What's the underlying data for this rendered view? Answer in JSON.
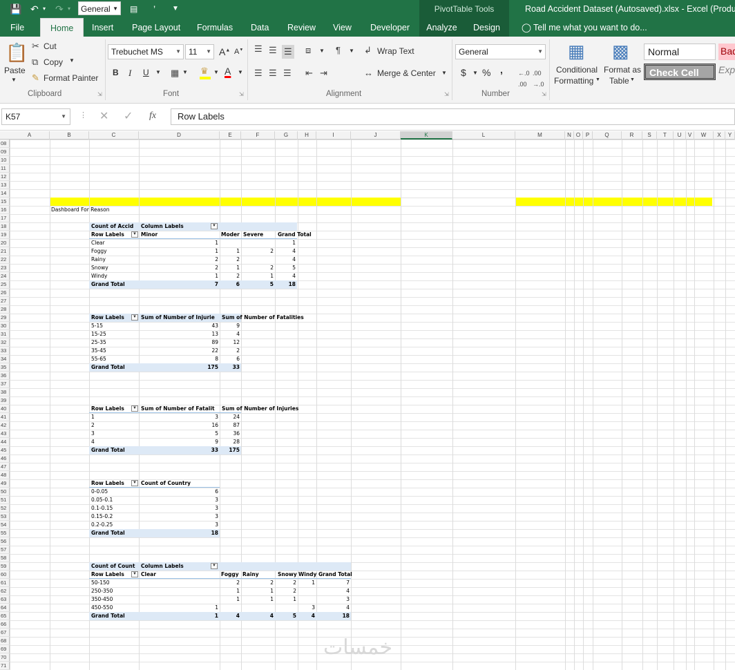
{
  "titlebar": {
    "number_format_box": "General",
    "contextual_group": "PivotTable Tools",
    "document_title": "Road Accident Dataset (Autosaved).xlsx - Excel (Product A"
  },
  "tabs": [
    "File",
    "Home",
    "Insert",
    "Page Layout",
    "Formulas",
    "Data",
    "Review",
    "View",
    "Developer",
    "Analyze",
    "Design"
  ],
  "tell_me": "Tell me what you want to do...",
  "ribbon": {
    "clipboard": {
      "paste": "Paste",
      "cut": "Cut",
      "copy": "Copy",
      "format_painter": "Format Painter",
      "label": "Clipboard"
    },
    "font": {
      "name": "Trebuchet MS",
      "size": "11",
      "bold": "B",
      "italic": "I",
      "underline": "U",
      "label": "Font"
    },
    "alignment": {
      "wrap_text": "Wrap Text",
      "merge_center": "Merge & Center",
      "label": "Alignment"
    },
    "number": {
      "format": "General",
      "currency": "$",
      "percent": "%",
      "comma": ",",
      "label": "Number"
    },
    "styles": {
      "conditional_formatting_1": "Conditional",
      "conditional_formatting_2": "Formatting",
      "format_as_table_1": "Format as",
      "format_as_table_2": "Table",
      "normal": "Normal",
      "bad": "Bad",
      "check_cell": "Check Cell",
      "explanatory": "Exp"
    }
  },
  "formula_bar": {
    "name_box": "K57",
    "formula": "Row Labels"
  },
  "columns": [
    "A",
    "B",
    "C",
    "D",
    "E",
    "F",
    "G",
    "H",
    "I",
    "J",
    "K",
    "L",
    "M",
    "N",
    "O",
    "P",
    "Q",
    "R",
    "S",
    "T",
    "U",
    "V",
    "W",
    "X",
    "Y"
  ],
  "rows": [
    "08",
    "09",
    "10",
    "11",
    "12",
    "13",
    "14",
    "15",
    "16",
    "17",
    "18",
    "19",
    "20",
    "21",
    "22",
    "23",
    "24",
    "25",
    "26",
    "27",
    "28",
    "29",
    "30",
    "31",
    "32",
    "33",
    "34",
    "35",
    "36",
    "37",
    "38",
    "39",
    "40",
    "41",
    "42",
    "43",
    "44",
    "45",
    "46",
    "47",
    "48",
    "49",
    "50",
    "51",
    "52",
    "53",
    "54",
    "55",
    "56",
    "57",
    "58",
    "59",
    "60",
    "61",
    "62",
    "63",
    "64",
    "65",
    "66",
    "67",
    "68",
    "69",
    "70",
    "71"
  ],
  "sheet": {
    "dashboard_title": "Dashboard For Reason",
    "pivot1": {
      "corner": "Count of Accid",
      "col_labels": "Column Labels",
      "row_labels": "Row Labels",
      "headers": [
        "Minor",
        "Moder",
        "Severe",
        "Grand Total"
      ],
      "rows": [
        {
          "label": "Clear",
          "vals": [
            "1",
            "",
            "",
            "1"
          ]
        },
        {
          "label": "Foggy",
          "vals": [
            "1",
            "1",
            "2",
            "4"
          ]
        },
        {
          "label": "Rainy",
          "vals": [
            "2",
            "2",
            "",
            "4"
          ]
        },
        {
          "label": "Snowy",
          "vals": [
            "2",
            "1",
            "2",
            "5"
          ]
        },
        {
          "label": "Windy",
          "vals": [
            "1",
            "2",
            "1",
            "4"
          ]
        }
      ],
      "total": {
        "label": "Grand Total",
        "vals": [
          "7",
          "6",
          "5",
          "18"
        ]
      }
    },
    "pivot2": {
      "row_labels": "Row Labels",
      "h1": "Sum of Number of Injurie",
      "h2": "Sum of Number of Fatalities",
      "rows": [
        {
          "label": "5-15",
          "v1": "43",
          "v2": "9"
        },
        {
          "label": "15-25",
          "v1": "13",
          "v2": "4"
        },
        {
          "label": "25-35",
          "v1": "89",
          "v2": "12"
        },
        {
          "label": "35-45",
          "v1": "22",
          "v2": "2"
        },
        {
          "label": "55-65",
          "v1": "8",
          "v2": "6"
        }
      ],
      "total": {
        "label": "Grand Total",
        "v1": "175",
        "v2": "33"
      }
    },
    "pivot3": {
      "row_labels": "Row Labels",
      "h1": "Sum of Number of Fatalit",
      "h2": "Sum of Number of Injuries",
      "rows": [
        {
          "label": "1",
          "v1": "3",
          "v2": "24"
        },
        {
          "label": "2",
          "v1": "16",
          "v2": "87"
        },
        {
          "label": "3",
          "v1": "5",
          "v2": "36"
        },
        {
          "label": "4",
          "v1": "9",
          "v2": "28"
        }
      ],
      "total": {
        "label": "Grand Total",
        "v1": "33",
        "v2": "175"
      }
    },
    "pivot4": {
      "row_labels": "Row Labels",
      "h1": "Count of Country",
      "rows": [
        {
          "label": "0-0.05",
          "v1": "6"
        },
        {
          "label": "0.05-0.1",
          "v1": "3"
        },
        {
          "label": "0.1-0.15",
          "v1": "3"
        },
        {
          "label": "0.15-0.2",
          "v1": "3"
        },
        {
          "label": "0.2-0.25",
          "v1": "3"
        }
      ],
      "total": {
        "label": "Grand Total",
        "v1": "18"
      }
    },
    "pivot5": {
      "corner": "Count of Count",
      "col_labels": "Column Labels",
      "row_labels": "Row Labels",
      "headers": [
        "Clear",
        "Foggy",
        "Rainy",
        "Snowy",
        "Windy",
        "Grand Total"
      ],
      "rows": [
        {
          "label": "50-150",
          "vals": [
            "",
            "2",
            "2",
            "2",
            "1",
            "7"
          ]
        },
        {
          "label": "250-350",
          "vals": [
            "",
            "1",
            "1",
            "2",
            "",
            "4"
          ]
        },
        {
          "label": "350-450",
          "vals": [
            "",
            "1",
            "1",
            "1",
            "",
            "3"
          ]
        },
        {
          "label": "450-550",
          "vals": [
            "1",
            "",
            "",
            "",
            "3",
            "4"
          ]
        }
      ],
      "total": {
        "label": "Grand Total",
        "vals": [
          "1",
          "4",
          "4",
          "5",
          "4",
          "18"
        ]
      }
    }
  },
  "watermark": "خمسات"
}
